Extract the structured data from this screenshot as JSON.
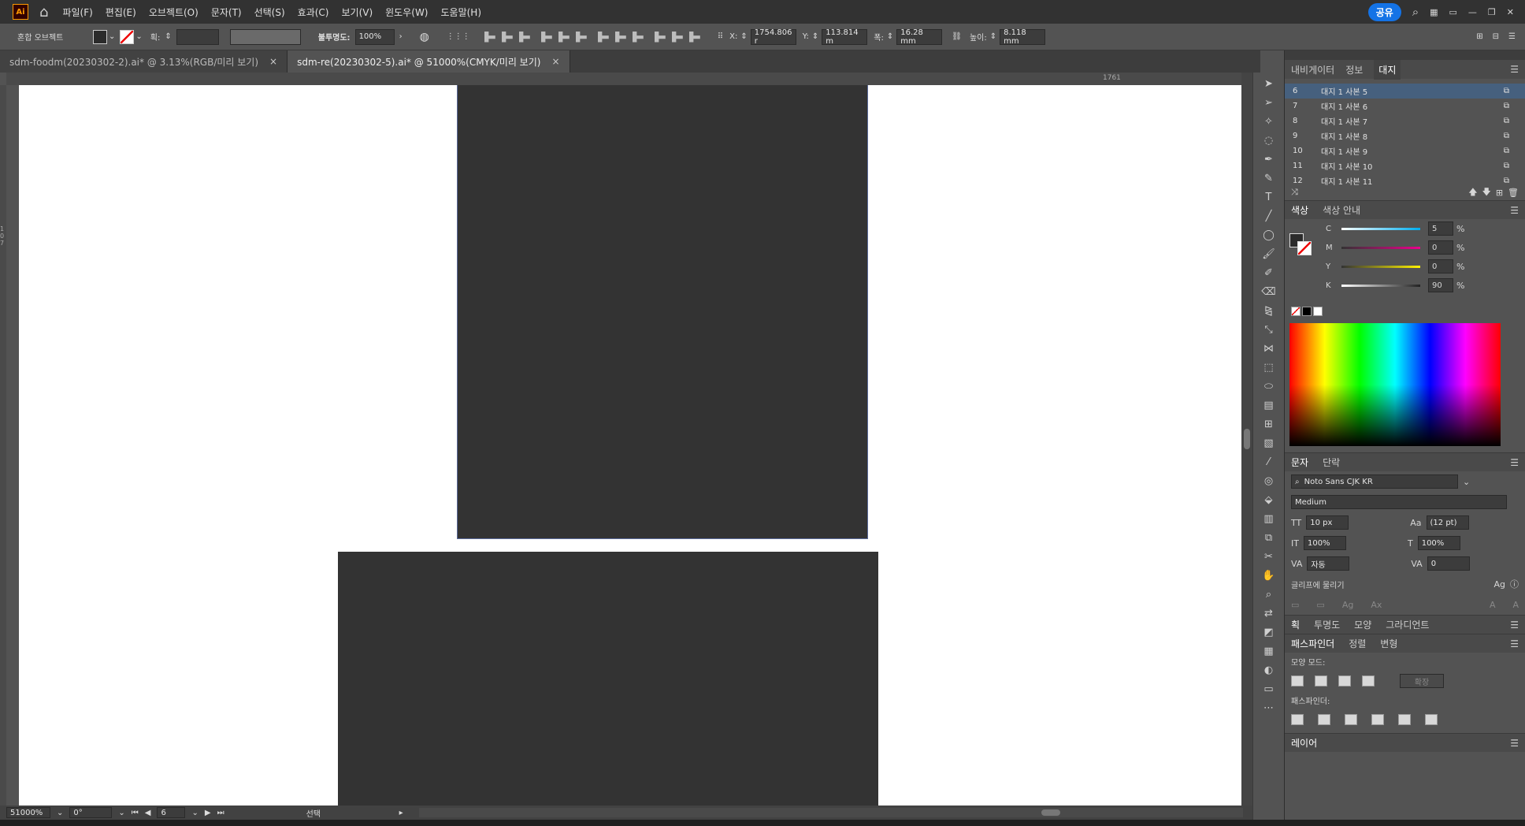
{
  "menubar": {
    "logo": "Ai",
    "menus": [
      "파일(F)",
      "편집(E)",
      "오브젝트(O)",
      "문자(T)",
      "선택(S)",
      "효과(C)",
      "보기(V)",
      "윈도우(W)",
      "도움말(H)"
    ],
    "share_label": "공유"
  },
  "control": {
    "selection_label": "혼합 오브젝트",
    "stroke_label": "획:",
    "opacity_label": "불투명도:",
    "opacity_value": "100%",
    "x_label": "X:",
    "x_value": "1754.806 r",
    "y_label": "Y:",
    "y_value": "113.814 m",
    "w_label": "폭:",
    "w_value": "16.28 mm",
    "h_label": "높이:",
    "h_value": "8.118 mm"
  },
  "tabs": [
    {
      "label": "sdm-foodm(20230302-2).ai* @ 3.13%(RGB/미리 보기)",
      "close": "×"
    },
    {
      "label": "sdm-re(20230302-5).ai* @ 51000%(CMYK/미리 보기)",
      "close": "×"
    }
  ],
  "ruler": {
    "top_mark": "1761",
    "left_mark": "107"
  },
  "status": {
    "zoom": "51000%",
    "rotation": "0°",
    "artboard_no": "6",
    "mode": "선택"
  },
  "panel": {
    "top_tabs": [
      "내비게이터",
      "정보",
      "대지"
    ],
    "artboards": [
      {
        "num": "6",
        "name": "대지 1 사본 5"
      },
      {
        "num": "7",
        "name": "대지 1 사본 6"
      },
      {
        "num": "8",
        "name": "대지 1 사본 7"
      },
      {
        "num": "9",
        "name": "대지 1 사본 8"
      },
      {
        "num": "10",
        "name": "대지 1 사본 9"
      },
      {
        "num": "11",
        "name": "대지 1 사본 10"
      },
      {
        "num": "12",
        "name": "대지 1 사본 11"
      }
    ],
    "color_tabs": [
      "색상",
      "색상 안내"
    ],
    "cmyk": [
      {
        "label": "C",
        "value": "5",
        "color": "#00aeef"
      },
      {
        "label": "M",
        "value": "0",
        "color": "#ec008c"
      },
      {
        "label": "Y",
        "value": "0",
        "color": "#fff200"
      },
      {
        "label": "K",
        "value": "90",
        "color": "#ffffff"
      }
    ],
    "percent": "%",
    "type_tabs": [
      "문자",
      "단락"
    ],
    "font_family": "Noto Sans CJK KR",
    "font_style": "Medium",
    "font_size": "10 px",
    "leading": "(12 pt)",
    "v_scale": "100%",
    "h_scale": "100%",
    "kerning": "자동",
    "tracking": "0",
    "snap_label": "글리프에 물리기",
    "stroke_tabs": [
      "획",
      "투명도",
      "모양",
      "그라디언트"
    ],
    "pathfinder_tabs": [
      "패스파인더",
      "정렬",
      "변형"
    ],
    "shape_modes": "모양 모드:",
    "expand": "확장",
    "pathfinders": "패스파인더:",
    "layers": "레이어"
  }
}
